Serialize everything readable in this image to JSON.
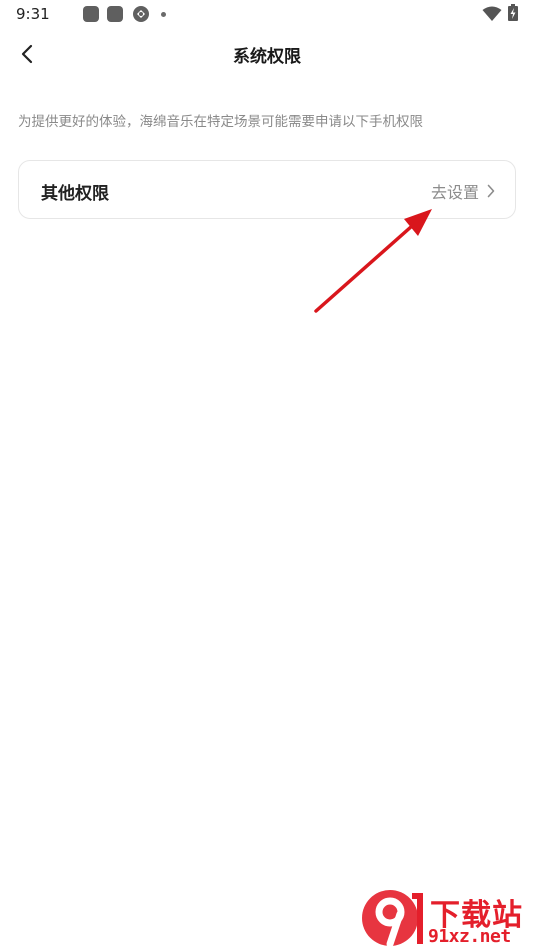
{
  "status_bar": {
    "time": "9:31",
    "icons": [
      "app-notification-icon",
      "app-notification-icon",
      "sync-icon",
      "more-dot-icon",
      "wifi-icon",
      "battery-icon"
    ]
  },
  "header": {
    "back_icon": "chevron-left-icon",
    "title": "系统权限"
  },
  "main": {
    "description": "为提供更好的体验，海绵音乐在特定场景可能需要申请以下手机权限",
    "permission_item": {
      "label": "其他权限",
      "action": "去设置",
      "action_icon": "chevron-right-icon"
    }
  },
  "annotation": {
    "type": "red-arrow",
    "color": "#d9161c"
  },
  "watermark": {
    "logo_text": "9",
    "title": "下载站",
    "url": "91xz.net",
    "color": "#e41f2b"
  }
}
